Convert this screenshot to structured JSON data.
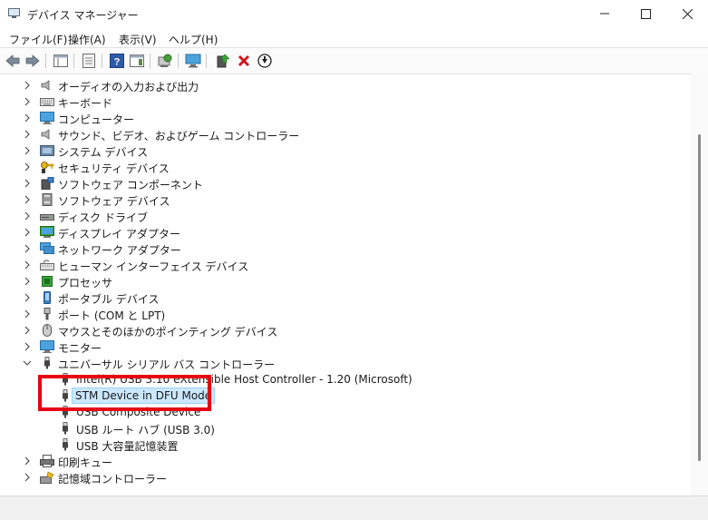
{
  "window": {
    "title": "デバイス マネージャー"
  },
  "menu": [
    "ファイル(F)",
    "操作(A)",
    "表示(V)",
    "ヘルプ(H)"
  ],
  "colors": {
    "highlight_box": "#e60012",
    "selection": "#cce8ff"
  },
  "tree": [
    {
      "label": "オーディオの入力および出力",
      "icon": "speaker-icon",
      "expanded": false
    },
    {
      "label": "キーボード",
      "icon": "keyboard-icon",
      "expanded": false
    },
    {
      "label": "コンピューター",
      "icon": "monitor-icon",
      "expanded": false
    },
    {
      "label": "サウンド、ビデオ、およびゲーム コントローラー",
      "icon": "speaker-icon",
      "expanded": false
    },
    {
      "label": "システム デバイス",
      "icon": "system-device-icon",
      "expanded": false
    },
    {
      "label": "セキュリティ デバイス",
      "icon": "key-icon",
      "expanded": false
    },
    {
      "label": "ソフトウェア コンポーネント",
      "icon": "software-component-icon",
      "expanded": false
    },
    {
      "label": "ソフトウェア デバイス",
      "icon": "software-device-icon",
      "expanded": false
    },
    {
      "label": "ディスク ドライブ",
      "icon": "disk-drive-icon",
      "expanded": false
    },
    {
      "label": "ディスプレイ アダプター",
      "icon": "display-adapter-icon",
      "expanded": false
    },
    {
      "label": "ネットワーク アダプター",
      "icon": "network-icon",
      "expanded": false
    },
    {
      "label": "ヒューマン インターフェイス デバイス",
      "icon": "hid-icon",
      "expanded": false
    },
    {
      "label": "プロセッサ",
      "icon": "processor-icon",
      "expanded": false
    },
    {
      "label": "ポータブル デバイス",
      "icon": "portable-device-icon",
      "expanded": false
    },
    {
      "label": "ポート (COM と LPT)",
      "icon": "port-icon",
      "expanded": false
    },
    {
      "label": "マウスとそのほかのポインティング デバイス",
      "icon": "mouse-icon",
      "expanded": false
    },
    {
      "label": "モニター",
      "icon": "monitor-icon",
      "expanded": false
    },
    {
      "label": "ユニバーサル シリアル バス コントローラー",
      "icon": "usb-icon",
      "expanded": true
    },
    {
      "label": "Intel(R) USB 3.10 eXtensible Host Controller - 1.20 (Microsoft)",
      "icon": "usb-icon",
      "child": true
    },
    {
      "label": "STM Device in DFU Mode",
      "icon": "usb-icon",
      "child": true,
      "selected": true
    },
    {
      "label": "USB Composite Device",
      "icon": "usb-icon",
      "child": true
    },
    {
      "label": "USB ルート ハブ (USB 3.0)",
      "icon": "usb-icon",
      "child": true
    },
    {
      "label": "USB 大容量記憶装置",
      "icon": "usb-icon",
      "child": true
    },
    {
      "label": "印刷キュー",
      "icon": "printer-icon",
      "expanded": false
    },
    {
      "label": "記憶域コントローラー",
      "icon": "storage-controller-icon",
      "expanded": false
    }
  ]
}
